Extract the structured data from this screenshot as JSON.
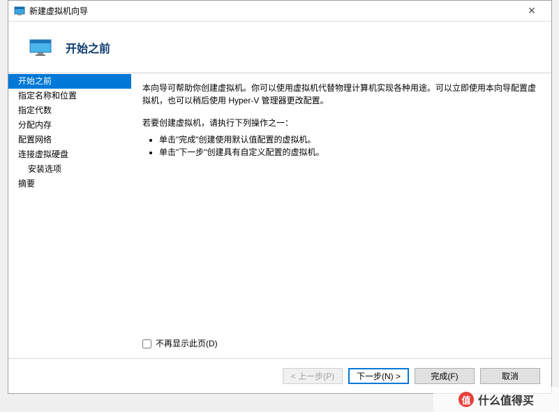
{
  "window": {
    "title": "新建虚拟机向导"
  },
  "header": {
    "page_title": "开始之前"
  },
  "sidebar": {
    "items": [
      {
        "label": "开始之前",
        "selected": true
      },
      {
        "label": "指定名称和位置"
      },
      {
        "label": "指定代数"
      },
      {
        "label": "分配内存"
      },
      {
        "label": "配置网络"
      },
      {
        "label": "连接虚拟硬盘"
      },
      {
        "label": "安装选项",
        "indent": true
      },
      {
        "label": "摘要"
      }
    ]
  },
  "content": {
    "intro": "本向导可帮助你创建虚拟机。你可以使用虚拟机代替物理计算机实现各种用途。可以立即使用本向导配置虚拟机，也可以稍后使用 Hyper-V 管理器更改配置。",
    "prompt": "若要创建虚拟机，请执行下列操作之一：",
    "bullets": [
      "单击\"完成\"创建使用默认值配置的虚拟机。",
      "单击\"下一步\"创建具有自定义配置的虚拟机。"
    ],
    "checkbox_label": "不再显示此页(D)"
  },
  "footer": {
    "prev": "< 上一步(P)",
    "next": "下一步(N) >",
    "finish": "完成(F)",
    "cancel": "取消"
  },
  "watermark": {
    "logo_char": "值",
    "text": "什么值得买"
  }
}
